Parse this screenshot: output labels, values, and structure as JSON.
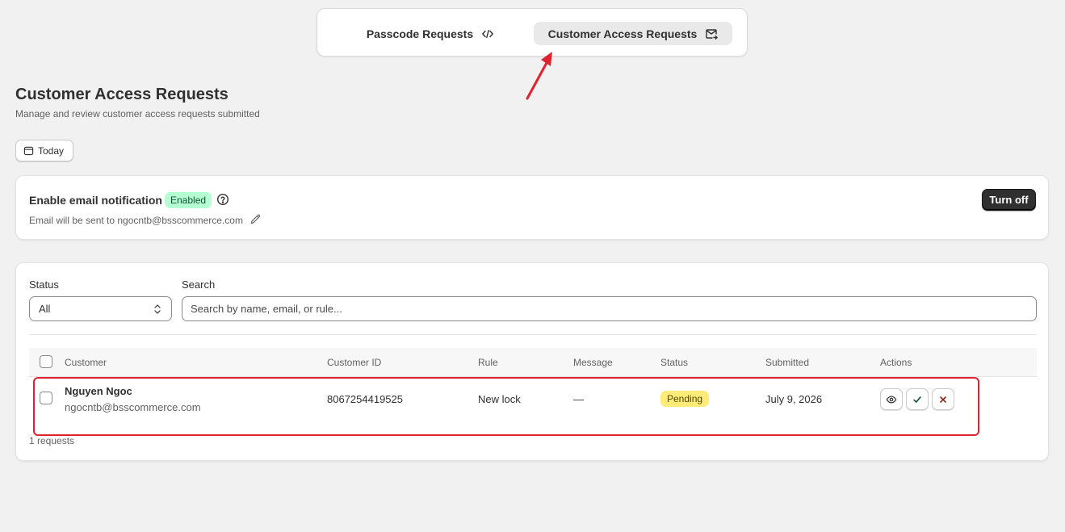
{
  "tabs": [
    {
      "label": "Passcode Requests",
      "icon": "code-icon",
      "active": false
    },
    {
      "label": "Customer Access Requests",
      "icon": "mail-forward-icon",
      "active": true
    }
  ],
  "page": {
    "title": "Customer Access Requests",
    "subtitle": "Manage and review customer access requests submitted"
  },
  "date_filter": {
    "label": "Today",
    "icon": "calendar-icon"
  },
  "notification": {
    "title": "Enable email notification",
    "status": "Enabled",
    "email_text": "Email will be sent to ngocntb@bsscommerce.com",
    "toggle_label": "Turn off"
  },
  "filters": {
    "status_label": "Status",
    "status_value": "All",
    "search_label": "Search",
    "search_placeholder": "Search by name, email, or rule..."
  },
  "table": {
    "columns": [
      "Customer",
      "Customer ID",
      "Rule",
      "Message",
      "Status",
      "Submitted",
      "Actions"
    ],
    "rows": [
      {
        "name": "Nguyen Ngoc",
        "email": "ngocntb@bsscommerce.com",
        "customer_id": "8067254419525",
        "rule": "New lock",
        "message": "—",
        "status": "Pending",
        "submitted": "July 9, 2026"
      }
    ],
    "count_text": "1 requests"
  },
  "colors": {
    "enabled_bg": "#b4fed2",
    "pending_bg": "#ffeb78",
    "highlight": "#e0222e",
    "primary_button": "#303030"
  }
}
